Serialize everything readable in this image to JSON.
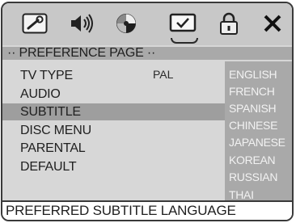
{
  "icons": {
    "general": "wrench-icon",
    "audio": "speaker-icon",
    "video": "color-wheel-icon",
    "preference": "checkmark-screen-icon",
    "password": "padlock-icon",
    "exit": "close-icon"
  },
  "header": {
    "title": "·· PREFERENCE PAGE ··"
  },
  "menu": {
    "items": [
      {
        "label": "TV TYPE"
      },
      {
        "label": "AUDIO"
      },
      {
        "label": "SUBTITLE"
      },
      {
        "label": "DISC MENU"
      },
      {
        "label": "PARENTAL"
      },
      {
        "label": "DEFAULT"
      }
    ],
    "selected": "SUBTITLE"
  },
  "tv_type_value": "PAL",
  "options": [
    "ENGLISH",
    "FRENCH",
    "SPANISH",
    "CHINESE",
    "JAPANESE",
    "KOREAN",
    "RUSSIAN",
    "THAI"
  ],
  "status": {
    "text": "PREFERRED SUBTITLE LANGUAGE"
  },
  "colors": {
    "icon_bar": "#c8c8c8",
    "menu_background": "#d7d7d7",
    "header_band": "#a9a9a9",
    "selection_highlight": "#9e9e9e",
    "options_panel": "#a9a9a9",
    "option_text": "#f2f2f2"
  }
}
